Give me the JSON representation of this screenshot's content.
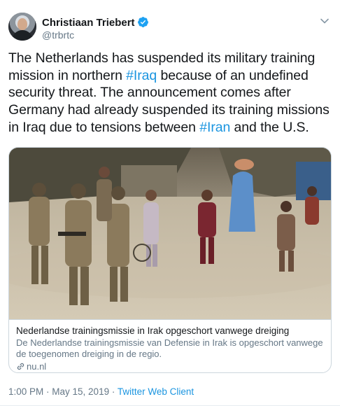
{
  "author": {
    "name": "Christiaan Triebert",
    "handle": "@trbrtc",
    "verified": true
  },
  "tweet": {
    "segments": [
      {
        "text": "The Netherlands has suspended its military training mission in northern ",
        "type": "text"
      },
      {
        "text": "#Iraq",
        "type": "hashtag"
      },
      {
        "text": " because of an undefined security threat. The announcement comes after Germany had already suspended its training missions in Iraq due to tensions between ",
        "type": "text"
      },
      {
        "text": "#Iran",
        "type": "hashtag"
      },
      {
        "text": " and the U.S.",
        "type": "text"
      }
    ]
  },
  "card": {
    "title": "Nederlandse trainingsmissie in Irak opgeschort vanwege dreiging",
    "description": "De Nederlandse trainingsmissie van Defensie in Irak is opgeschort vanwege de toegenomen dreiging in de regio.",
    "domain": "nu.nl",
    "image_icon": "news-photo"
  },
  "meta": {
    "time": "1:00 PM",
    "separator": " · ",
    "date": "May 15, 2019",
    "source": "Twitter Web Client"
  },
  "colors": {
    "link": "#1b95e0",
    "verified": "#1da1f2",
    "secondary_text": "#657786",
    "border": "#ccd6dd"
  },
  "icons": {
    "verified": "verified-badge-icon",
    "caret": "chevron-down-icon",
    "link": "link-icon"
  }
}
